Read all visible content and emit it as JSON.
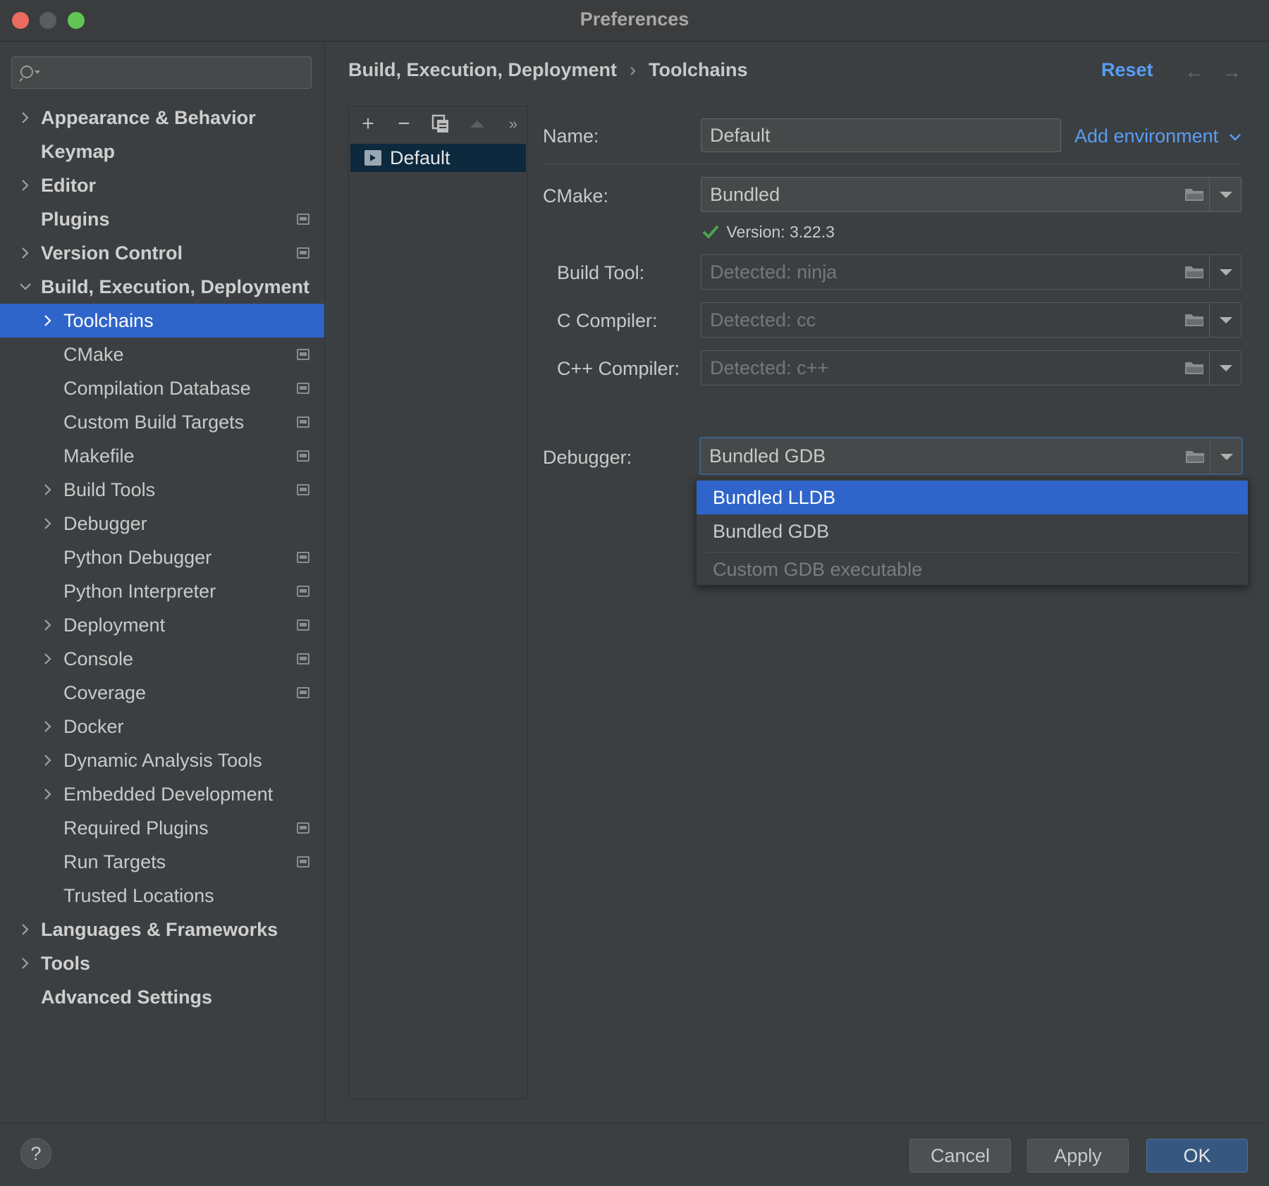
{
  "window": {
    "title": "Preferences"
  },
  "search": {
    "placeholder": ""
  },
  "sidebar": {
    "items": [
      {
        "label": "Appearance & Behavior",
        "level": 0,
        "expandable": true,
        "expanded": false,
        "bold": true,
        "page_icon": false
      },
      {
        "label": "Keymap",
        "level": 0,
        "expandable": false,
        "bold": true,
        "page_icon": false
      },
      {
        "label": "Editor",
        "level": 0,
        "expandable": true,
        "expanded": false,
        "bold": true,
        "page_icon": false
      },
      {
        "label": "Plugins",
        "level": 0,
        "expandable": false,
        "bold": true,
        "page_icon": true
      },
      {
        "label": "Version Control",
        "level": 0,
        "expandable": true,
        "expanded": false,
        "bold": true,
        "page_icon": true
      },
      {
        "label": "Build, Execution, Deployment",
        "level": 0,
        "expandable": true,
        "expanded": true,
        "bold": true,
        "page_icon": false
      },
      {
        "label": "Toolchains",
        "level": 1,
        "expandable": true,
        "expanded": false,
        "selected": true,
        "page_icon": false
      },
      {
        "label": "CMake",
        "level": 1,
        "expandable": false,
        "page_icon": true
      },
      {
        "label": "Compilation Database",
        "level": 1,
        "expandable": false,
        "page_icon": true
      },
      {
        "label": "Custom Build Targets",
        "level": 1,
        "expandable": false,
        "page_icon": true
      },
      {
        "label": "Makefile",
        "level": 1,
        "expandable": false,
        "page_icon": true
      },
      {
        "label": "Build Tools",
        "level": 1,
        "expandable": true,
        "expanded": false,
        "page_icon": true
      },
      {
        "label": "Debugger",
        "level": 1,
        "expandable": true,
        "expanded": false,
        "page_icon": false
      },
      {
        "label": "Python Debugger",
        "level": 1,
        "expandable": false,
        "page_icon": true
      },
      {
        "label": "Python Interpreter",
        "level": 1,
        "expandable": false,
        "page_icon": true
      },
      {
        "label": "Deployment",
        "level": 1,
        "expandable": true,
        "expanded": false,
        "page_icon": true
      },
      {
        "label": "Console",
        "level": 1,
        "expandable": true,
        "expanded": false,
        "page_icon": true
      },
      {
        "label": "Coverage",
        "level": 1,
        "expandable": false,
        "page_icon": true
      },
      {
        "label": "Docker",
        "level": 1,
        "expandable": true,
        "expanded": false,
        "page_icon": false
      },
      {
        "label": "Dynamic Analysis Tools",
        "level": 1,
        "expandable": true,
        "expanded": false,
        "page_icon": false
      },
      {
        "label": "Embedded Development",
        "level": 1,
        "expandable": true,
        "expanded": false,
        "page_icon": false
      },
      {
        "label": "Required Plugins",
        "level": 1,
        "expandable": false,
        "page_icon": true
      },
      {
        "label": "Run Targets",
        "level": 1,
        "expandable": false,
        "page_icon": true
      },
      {
        "label": "Trusted Locations",
        "level": 1,
        "expandable": false,
        "page_icon": false
      },
      {
        "label": "Languages & Frameworks",
        "level": 0,
        "expandable": true,
        "expanded": false,
        "bold": true,
        "page_icon": false
      },
      {
        "label": "Tools",
        "level": 0,
        "expandable": true,
        "expanded": false,
        "bold": true,
        "page_icon": false
      },
      {
        "label": "Advanced Settings",
        "level": 0,
        "expandable": false,
        "bold": true,
        "page_icon": false
      }
    ]
  },
  "header": {
    "breadcrumb": [
      "Build, Execution, Deployment",
      "Toolchains"
    ],
    "breadcrumb_separator": "›",
    "reset_label": "Reset",
    "back_arrow": "←",
    "forward_arrow": "→"
  },
  "toolchain_list": {
    "toolbar": {
      "add": "+",
      "remove": "−",
      "more": "»"
    },
    "items": [
      "Default"
    ]
  },
  "form": {
    "name_label": "Name:",
    "name_value": "Default",
    "add_environment_label": "Add environment",
    "cmake_label": "CMake:",
    "cmake_value": "Bundled",
    "cmake_version": "Version: 3.22.3",
    "build_tool_label": "Build Tool:",
    "build_tool_value": "Detected: ninja",
    "c_compiler_label": "C Compiler:",
    "c_compiler_value": "Detected: cc",
    "cpp_compiler_label": "C++ Compiler:",
    "cpp_compiler_value": "Detected: c++",
    "debugger_label": "Debugger:",
    "debugger_value": "Bundled GDB"
  },
  "debugger_popup": {
    "options": [
      {
        "label": "Bundled LLDB",
        "highlighted": true
      },
      {
        "label": "Bundled GDB",
        "highlighted": false
      },
      {
        "label": "Custom GDB executable",
        "highlighted": false,
        "muted": true
      }
    ]
  },
  "footer": {
    "help_label": "?",
    "cancel_label": "Cancel",
    "apply_label": "Apply",
    "ok_label": "OK"
  },
  "colors": {
    "background": "#3c3f41",
    "selection": "#2f65ca",
    "link": "#589df6",
    "primary_button": "#365880",
    "check_green": "#4ea34d"
  }
}
